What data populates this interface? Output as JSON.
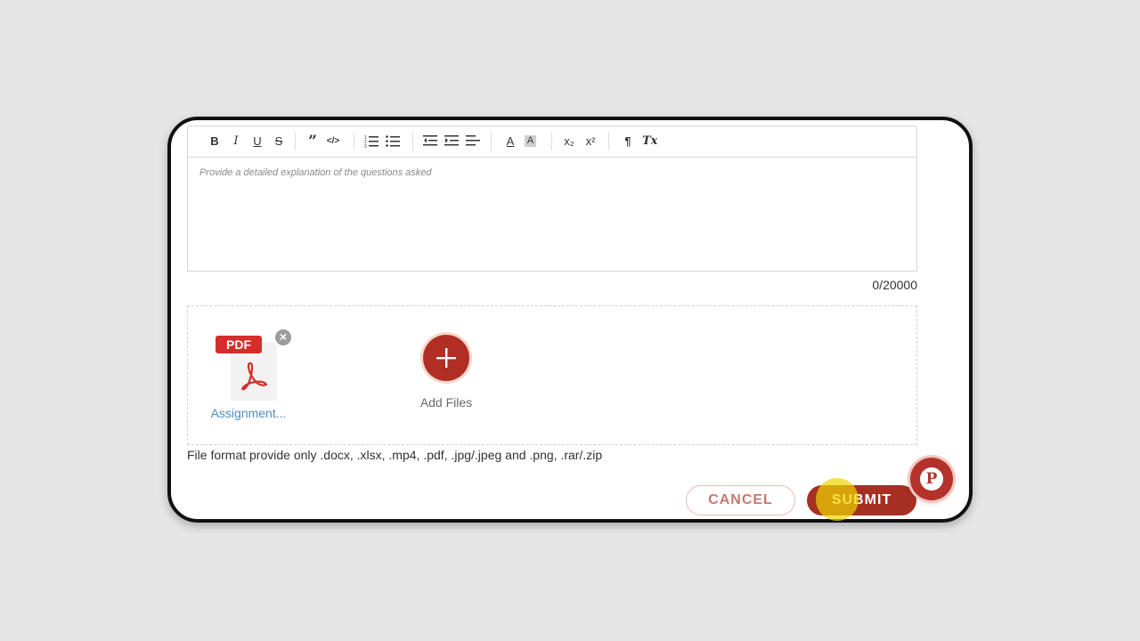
{
  "toolbar": {
    "items": [
      {
        "name": "bold",
        "label": "B"
      },
      {
        "name": "italic",
        "label": "I"
      },
      {
        "name": "underline",
        "label": "U"
      },
      {
        "name": "strikethrough",
        "label": "S"
      },
      {
        "name": "blockquote",
        "label": "”"
      },
      {
        "name": "code",
        "label": "</>"
      },
      {
        "name": "ordered-list",
        "label": ""
      },
      {
        "name": "bullet-list",
        "label": ""
      },
      {
        "name": "outdent",
        "label": ""
      },
      {
        "name": "indent",
        "label": ""
      },
      {
        "name": "align",
        "label": ""
      },
      {
        "name": "text-color",
        "label": "A"
      },
      {
        "name": "background-color",
        "label": "A"
      },
      {
        "name": "subscript",
        "label": "x₂"
      },
      {
        "name": "superscript",
        "label": "x²"
      },
      {
        "name": "text-direction",
        "label": "¶"
      },
      {
        "name": "clear-format",
        "label": "Tx"
      }
    ]
  },
  "editor": {
    "placeholder": "Provide a detailed explanation of the questions asked",
    "char_count": "0/20000"
  },
  "attachments": {
    "files": [
      {
        "name": "Assignment...",
        "type_label": "PDF",
        "icon": "pdf-icon"
      }
    ],
    "remove_symbol": "×",
    "add_label": "Add Files"
  },
  "hint": "File format provide only .docx, .xlsx, .mp4, .pdf, .jpg/.jpeg and .png, .rar/.zip",
  "actions": {
    "cancel_label": "CANCEL",
    "submit_label": "SUBMIT"
  },
  "chat": {
    "icon": "chat-logo-icon",
    "letter": "P"
  },
  "colors": {
    "primary": "#a62e22",
    "accent_light": "#f6d8cc",
    "link": "#4d8ec7",
    "pdf_red": "#d62d28"
  }
}
